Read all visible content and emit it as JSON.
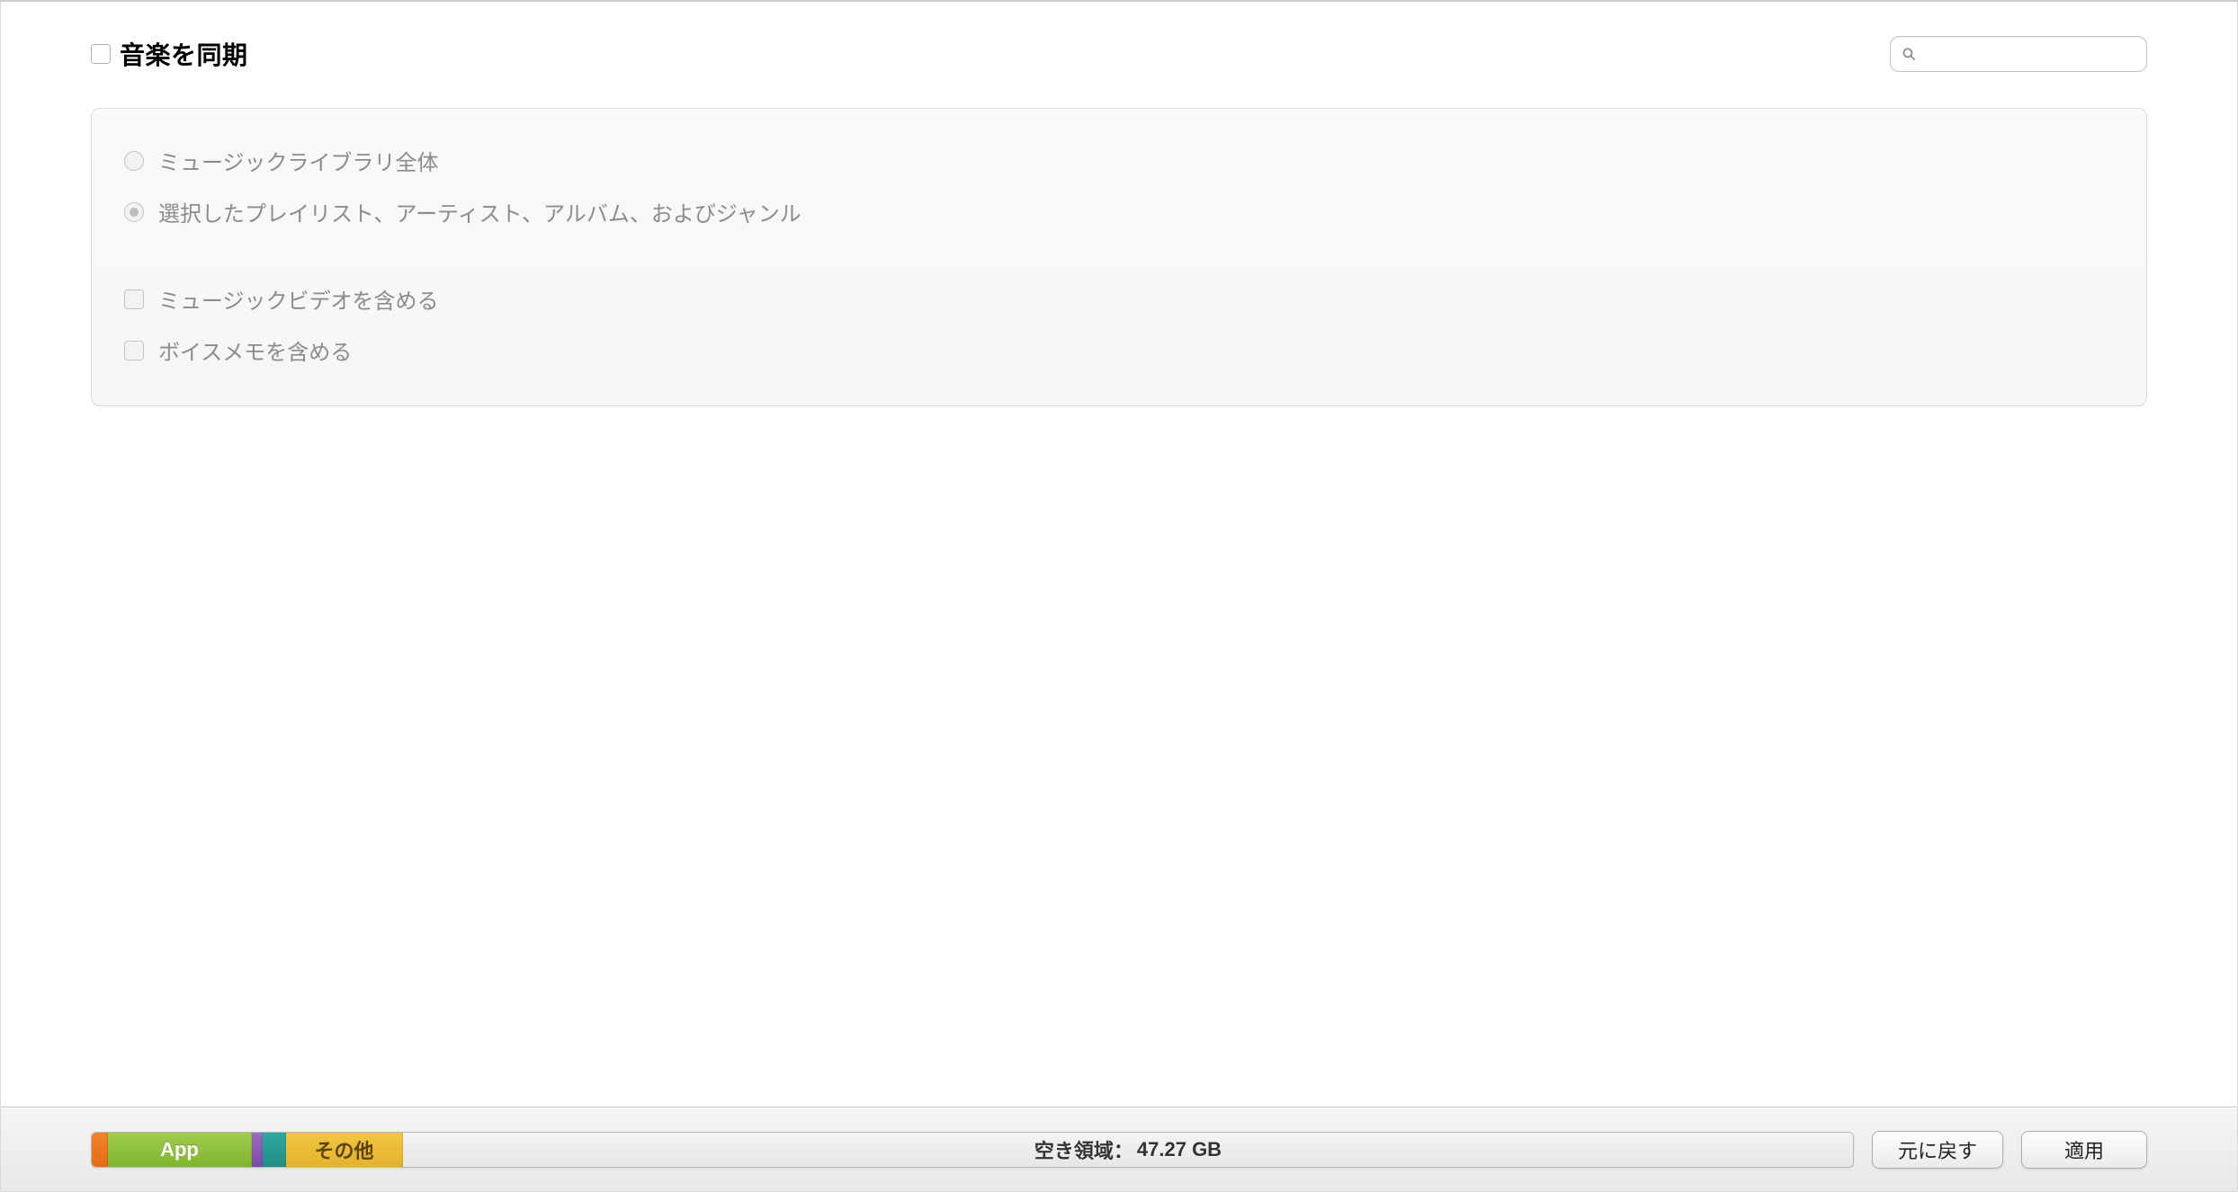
{
  "header": {
    "title": "音楽を同期",
    "search_placeholder": ""
  },
  "options": {
    "radio": {
      "entire_library": "ミュージックライブラリ全体",
      "selected_items": "選択したプレイリスト、アーティスト、アルバム、およびジャンル",
      "selected_index": 1
    },
    "checkboxes": {
      "include_music_videos": "ミュージックビデオを含める",
      "include_voice_memos": "ボイスメモを含める"
    }
  },
  "capacity": {
    "segments": {
      "app": "App",
      "other": "その他"
    },
    "free_label": "空き領域：",
    "free_value": "47.27 GB"
  },
  "buttons": {
    "revert": "元に戻す",
    "apply": "適用"
  }
}
